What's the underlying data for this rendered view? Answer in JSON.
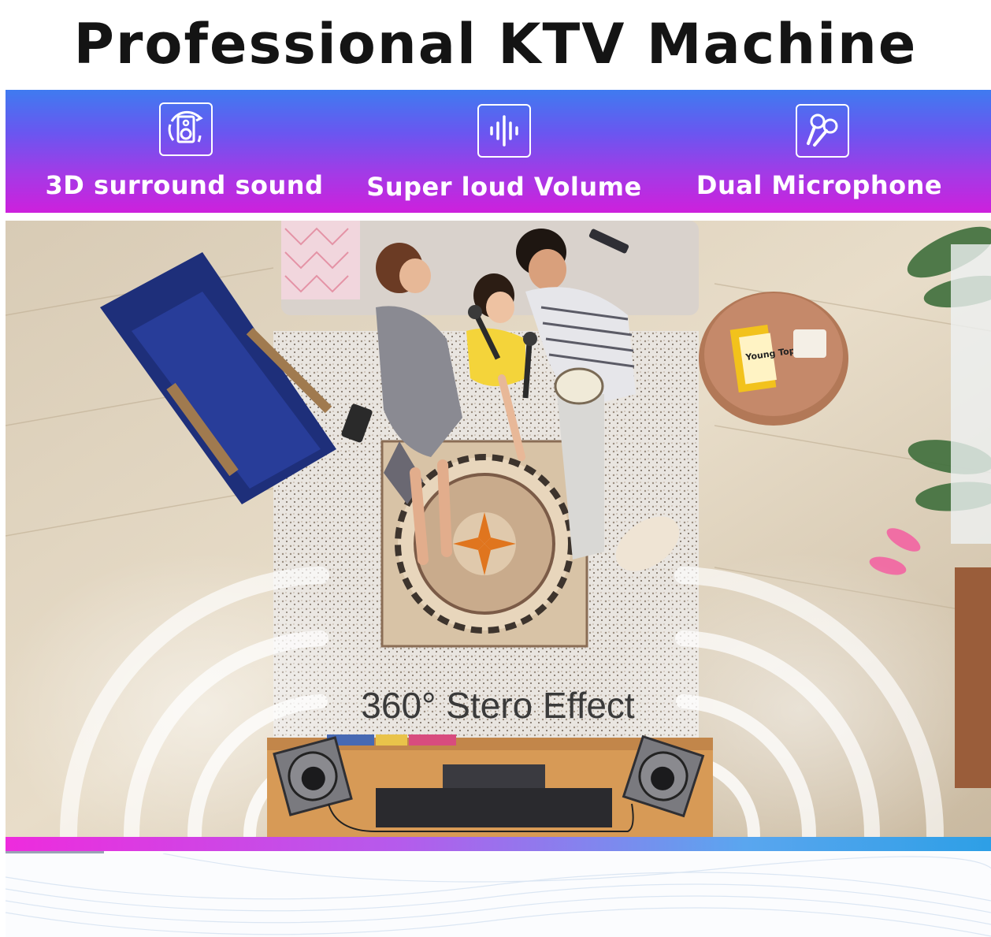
{
  "page": {
    "title": "Professional KTV Machine"
  },
  "features": [
    {
      "label": "3D surround sound",
      "icon": "speaker-surround-icon"
    },
    {
      "label": "Super loud Volume",
      "icon": "sound-wave-icon"
    },
    {
      "label": "Dual Microphone",
      "icon": "microphone-pair-icon"
    }
  ],
  "photo": {
    "caption": "360° Stero Effect",
    "book_text": "Young Top"
  },
  "colors": {
    "band_top": "#3f7bf0",
    "band_bottom": "#cf1fdc",
    "bar_left": "#ee2bdd",
    "bar_right": "#2d9fe6"
  }
}
